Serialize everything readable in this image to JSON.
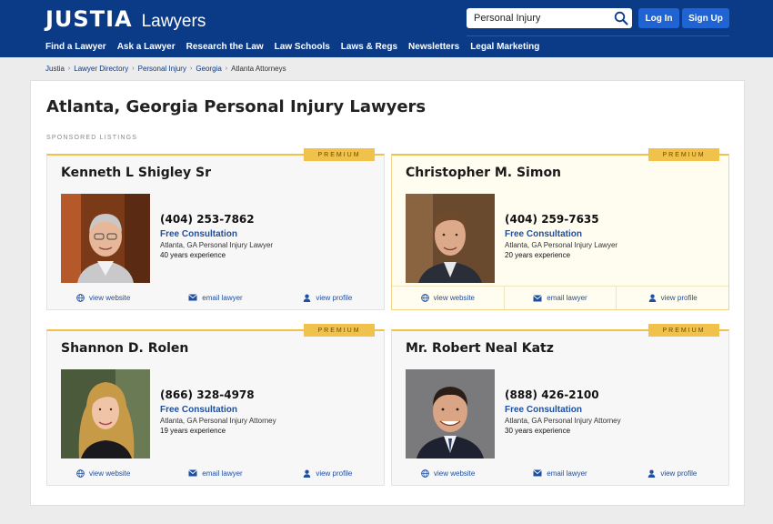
{
  "header": {
    "logo_main": "JUSTIA",
    "logo_sub": "Lawyers",
    "search_value": "Personal Injury",
    "login_label": "Log In",
    "signup_label": "Sign Up",
    "nav": [
      "Find a Lawyer",
      "Ask a Lawyer",
      "Research the Law",
      "Law Schools",
      "Laws & Regs",
      "Newsletters",
      "Legal Marketing"
    ]
  },
  "breadcrumb": {
    "items": [
      "Justia",
      "Lawyer Directory",
      "Personal Injury",
      "Georgia"
    ],
    "current": "Atlanta Attorneys"
  },
  "page": {
    "title": "Atlanta, Georgia Personal Injury Lawyers",
    "sponsored_label": "SPONSORED LISTINGS"
  },
  "listings": [
    {
      "badge": "PREMIUM",
      "name": "Kenneth L Shigley Sr",
      "phone": "(404) 253-7862",
      "consultation": "Free Consultation",
      "practice": "Atlanta, GA Personal Injury Lawyer",
      "experience": "40 years experience",
      "website_label": "view website",
      "email_label": "email lawyer",
      "profile_label": "view profile"
    },
    {
      "badge": "PREMIUM",
      "name": "Christopher M. Simon",
      "phone": "(404) 259-7635",
      "consultation": "Free Consultation",
      "practice": "Atlanta, GA Personal Injury Lawyer",
      "experience": "20 years experience",
      "website_label": "view website",
      "email_label": "email lawyer",
      "profile_label": "view profile"
    },
    {
      "badge": "PREMIUM",
      "name": "Shannon D. Rolen",
      "phone": "(866) 328-4978",
      "consultation": "Free Consultation",
      "practice": "Atlanta, GA Personal Injury Attorney",
      "experience": "19 years experience",
      "website_label": "view website",
      "email_label": "email lawyer",
      "profile_label": "view profile"
    },
    {
      "badge": "PREMIUM",
      "name": "Mr. Robert Neal Katz",
      "phone": "(888) 426-2100",
      "consultation": "Free Consultation",
      "practice": "Atlanta, GA Personal Injury Attorney",
      "experience": "30 years experience",
      "website_label": "view website",
      "email_label": "email lawyer",
      "profile_label": "view profile"
    }
  ],
  "colors": {
    "header_bg": "#0b3a86",
    "button_bg": "#1f64d2",
    "premium_gold": "#f0c14b",
    "link_blue": "#1f4fa0"
  },
  "icons": {
    "search": "search-icon",
    "website": "globe-icon",
    "email": "envelope-icon",
    "profile": "person-icon"
  }
}
